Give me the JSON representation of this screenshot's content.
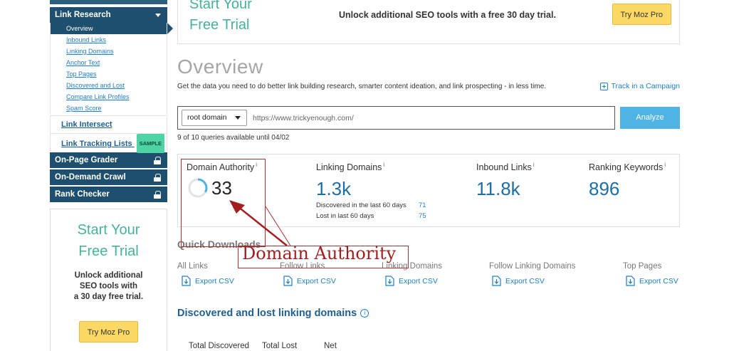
{
  "sidebar": {
    "section": "Link Research",
    "sub_items": [
      "Overview",
      "Inbound Links",
      "Linking Domains",
      "Anchor Text",
      "Top Pages",
      "Discovered and Lost",
      "Compare Link Profiles",
      "Spam Score"
    ],
    "link_intersect": "Link Intersect",
    "link_tracking": "Link Tracking Lists",
    "sample_badge": "SAMPLE",
    "locked_sections": [
      "On-Page Grader",
      "On-Demand Crawl",
      "Rank Checker"
    ],
    "trial": {
      "title_line1": "Start Your",
      "title_line2": "Free Trial",
      "text_line1": "Unlock additional",
      "text_line2": "SEO tools with",
      "text_line3": "a 30 day free trial.",
      "button": "Try Moz Pro"
    }
  },
  "banner": {
    "title_line1": "Start Your",
    "title_line2": "Free Trial",
    "text": "Unlock additional SEO tools with a free 30 day trial.",
    "button": "Try Moz Pro"
  },
  "main": {
    "title": "Overview",
    "description": "Get the data you need to do better link building research, smarter content ideation, and link prospecting - in less time.",
    "track_link": "Track in a Campaign",
    "search": {
      "scope": "root domain",
      "url": "https://www.trickyenough.com/",
      "button": "Analyze"
    },
    "quota": "9 of 10 queries available until 04/02",
    "metrics": {
      "domain_authority": {
        "label": "Domain Authority",
        "value": "33",
        "info": "i"
      },
      "linking_domains": {
        "label": "Linking Domains",
        "value": "1.3k",
        "info": "i",
        "discovered_label": "Discovered in the last 60 days",
        "discovered_value": "71",
        "lost_label": "Lost in last 60 days",
        "lost_value": "75"
      },
      "inbound_links": {
        "label": "Inbound Links",
        "value": "11.8k",
        "info": "i"
      },
      "ranking_keywords": {
        "label": "Ranking Keywords",
        "value": "896",
        "info": "i"
      }
    },
    "annotation": "Domain Authority",
    "quick_downloads": {
      "title": "Quick Downloads",
      "columns": [
        {
          "label": "All Links",
          "export": "Export CSV"
        },
        {
          "label": "Follow Links",
          "export": "Export CSV"
        },
        {
          "label": "Linking Domains",
          "export": "Export CSV"
        },
        {
          "label": "Follow Linking Domains",
          "export": "Export CSV"
        },
        {
          "label": "Top Pages",
          "export": "Export CSV"
        }
      ]
    },
    "discovered_lost": {
      "title": "Discovered and lost linking domains",
      "info_icon": "i",
      "headers": [
        "Total Discovered",
        "Total Lost",
        "Net"
      ]
    }
  }
}
